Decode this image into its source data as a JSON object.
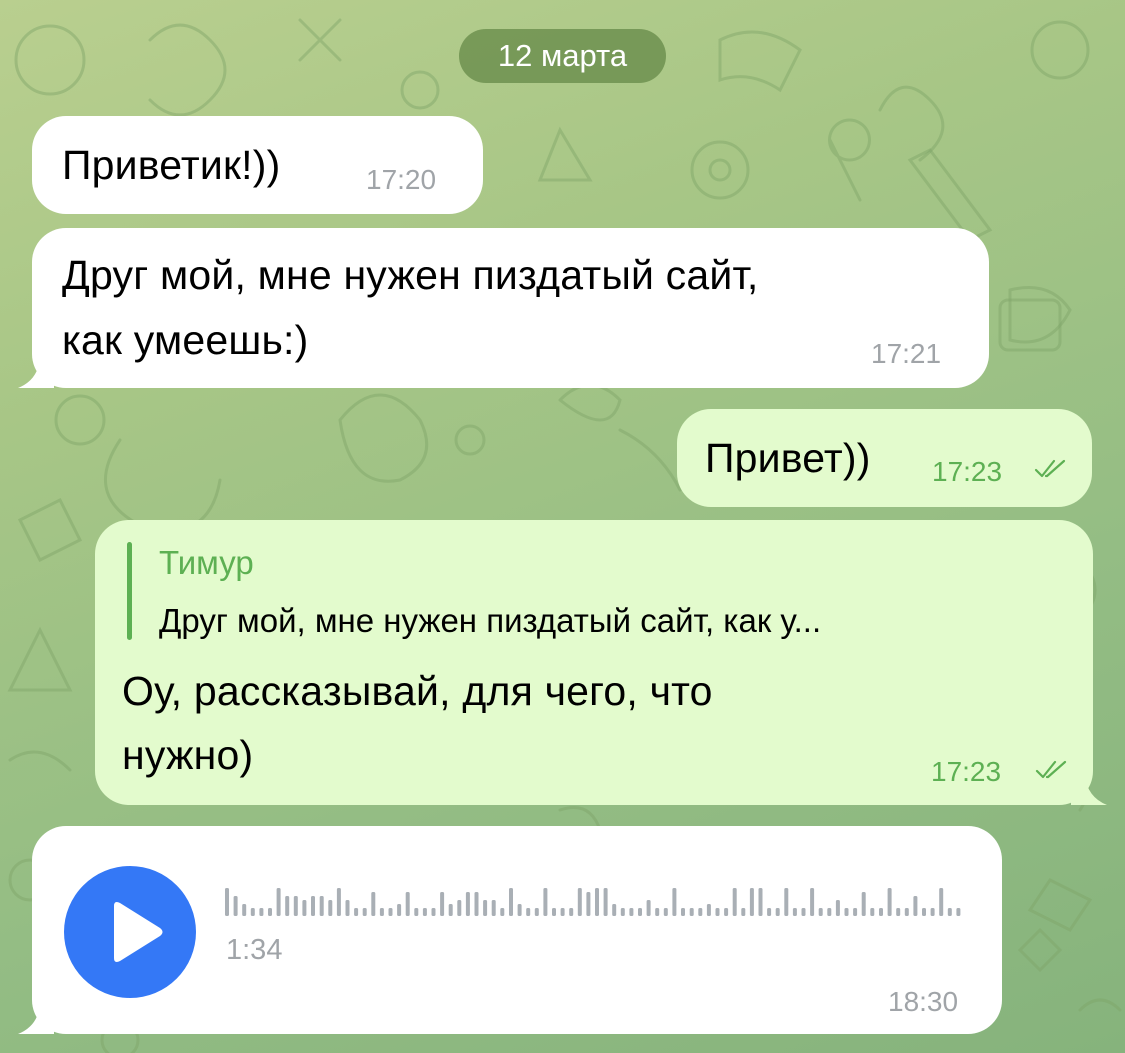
{
  "chat": {
    "date_label": "12 марта",
    "messages": [
      {
        "direction": "in",
        "text": "Приветик!))",
        "time": "17:20"
      },
      {
        "direction": "in",
        "text_lines": [
          "Друг мой, мне нужен пиздатый сайт,",
          "как умеешь:)"
        ],
        "time": "17:21"
      },
      {
        "direction": "out",
        "text": "Привет))",
        "time": "17:23",
        "status": "read"
      },
      {
        "direction": "out",
        "reply": {
          "author": "Тимур",
          "text": "Друг мой, мне нужен пиздатый сайт, как у..."
        },
        "text_lines": [
          "Оу, рассказывай, для чего, что",
          "нужно)"
        ],
        "time": "17:23",
        "status": "read"
      },
      {
        "direction": "in",
        "type": "voice",
        "duration": "1:34",
        "time": "18:30",
        "icon": "play-icon"
      }
    ]
  },
  "colors": {
    "incoming_bubble": "#ffffff",
    "outgoing_bubble": "#e3fbcd",
    "accent_green": "#5db053",
    "play_button": "#3478f6",
    "timestamp_gray": "#a0a4a8"
  }
}
